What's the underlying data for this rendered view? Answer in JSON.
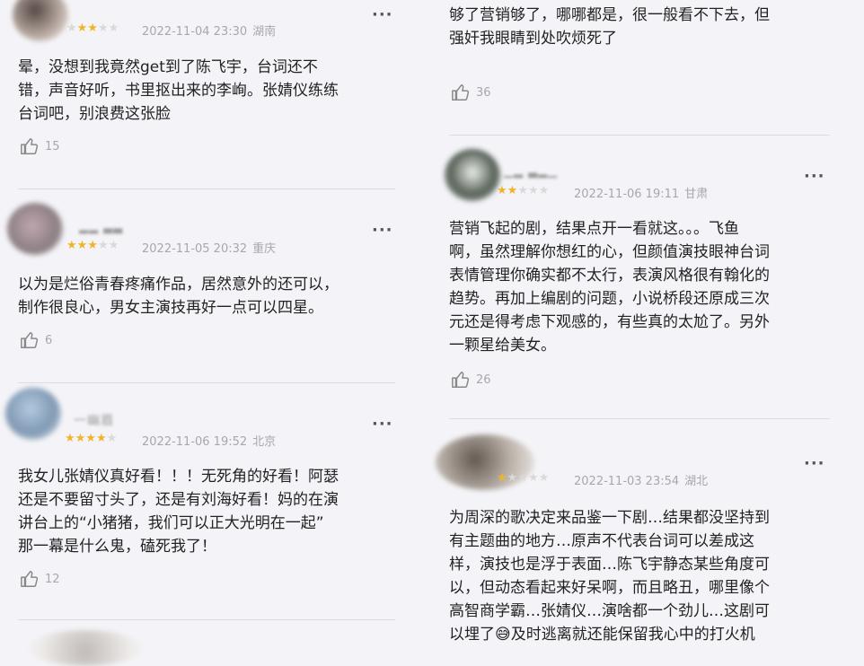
{
  "reviews_left": [
    {
      "date": "2022-11-04 23:30",
      "location": "湖南",
      "rating": 3,
      "username": "",
      "lines": [
        "晕，没想到我竟然get到了陈飞宇，台词还不",
        "错，声音好听，书里抠出来的李峋。张婧仪练练",
        "台词吧，别浪费这张脸"
      ],
      "likes": "15",
      "avatar_color": "#6b5a50"
    },
    {
      "date": "2022-11-05 20:32",
      "location": "重庆",
      "rating": 3,
      "username": "",
      "lines": [
        "以为是烂俗青春疼痛作品，居然意外的还可以，",
        "制作很良心，男女主演技再好一点可以四星。"
      ],
      "likes": "6",
      "avatar_color": "#8a7a82"
    },
    {
      "date": "2022-11-06 19:52",
      "location": "北京",
      "rating": 4,
      "username": "一幽眉",
      "lines": [
        "我女儿张婧仪真好看！！！无死角的好看！阿瑟",
        "还是不要留寸头了，还是有刘海好看！妈的在演",
        "讲台上的“小猪猪，我们可以正大光明在一起”",
        "那一幕是什么鬼，磕死我了！"
      ],
      "likes": "12",
      "avatar_color": "#9fb4c7"
    }
  ],
  "reviews_right": [
    {
      "lines": [
        "够了营销够了，哪哪都是，很一般看不下去，但",
        "强奸我眼睛到处吹烦死了"
      ],
      "likes": "36"
    },
    {
      "date": "2022-11-06 19:11",
      "location": "甘肃",
      "rating": 2,
      "username": "",
      "lines": [
        "营销飞起的剧，结果点开一看就这。。。飞鱼",
        "啊，虽然理解你想红的心，但颜值演技眼神台词",
        "表情管理你确实都不太行，表演风格很有翰化的",
        "趋势。再加上编剧的问题，小说桥段还原成三次",
        "元还是得考虑下观感的，有些真的太尬了。另外",
        "一颗星给美女。"
      ],
      "likes": "26",
      "avatar_color": "#3f4a3c"
    },
    {
      "date": "2022-11-03 23:54",
      "location": "湖北",
      "rating": 1,
      "username": "",
      "lines": [
        "为周深的歌决定来品鉴一下剧…结果都没坚持到",
        "有主题曲的地方…原声不代表台词可以差成这",
        "样，演技也是浮于表面…陈飞宇静态某些角度可",
        "以，但动态看起来好呆啊，而且略丑，哪里像个",
        "高智商学霸…张婧仪…演啥都一个劲儿…这剧可",
        "以埋了😅及时逃离就还能保留我心中的打火机"
      ],
      "avatar_color": "#5a5048"
    }
  ],
  "ui": {
    "more_label": "···",
    "like_icon": "thumbs-up-icon",
    "star_color": "#f0b429"
  }
}
